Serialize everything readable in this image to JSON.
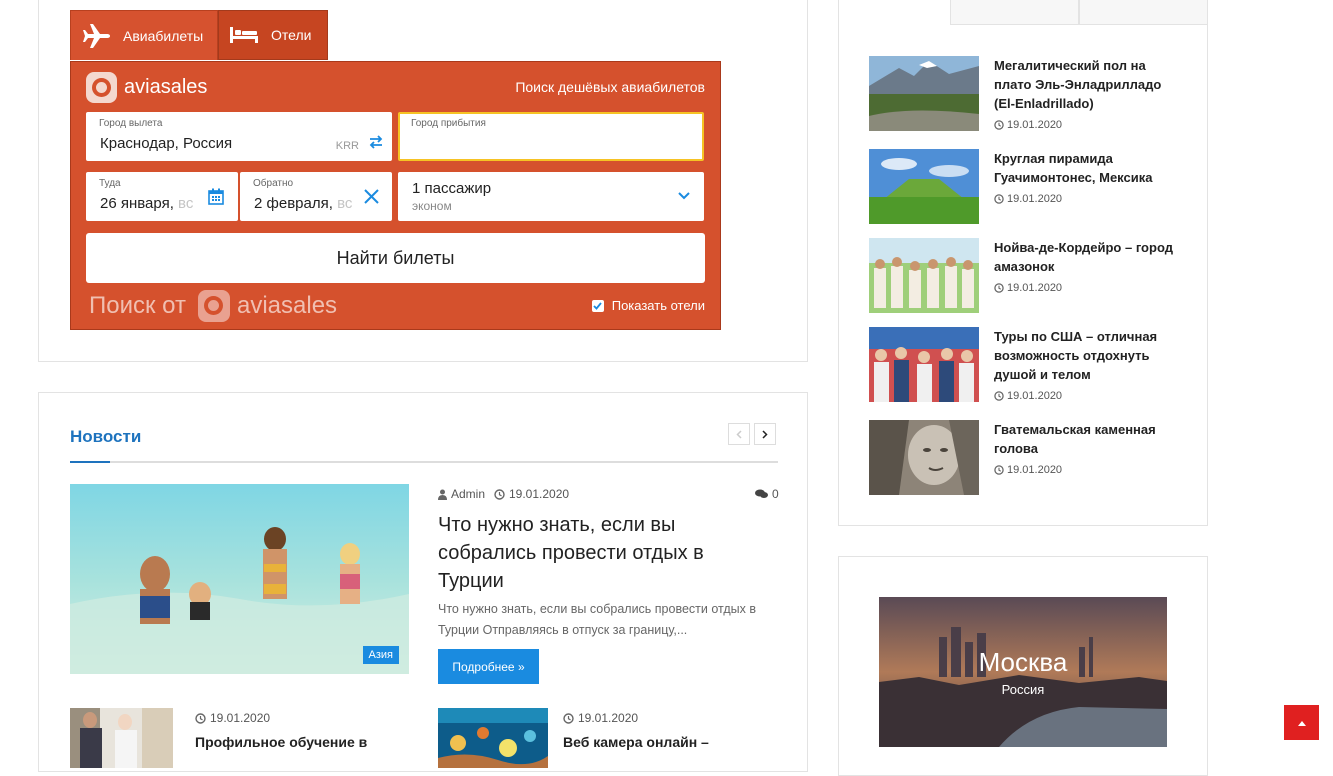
{
  "flight_widget": {
    "tabs": [
      {
        "label": "Авиабилеты",
        "icon": "airplane-icon"
      },
      {
        "label": "Отели",
        "icon": "bed-icon"
      }
    ],
    "brand": "aviasales",
    "tagline": "Поиск дешёвых авиабилетов",
    "origin": {
      "label": "Город вылета",
      "value": "Краснодар, Россия",
      "iata": "KRR"
    },
    "destination": {
      "label": "Город прибытия",
      "value": ""
    },
    "depart": {
      "label": "Туда",
      "value": "26 января,",
      "weekday": "вс"
    },
    "return": {
      "label": "Обратно",
      "value": "2 февраля,",
      "weekday": "вс"
    },
    "passengers": {
      "value": "1 пассажир",
      "class": "эконом"
    },
    "search_button": "Найти билеты",
    "powered_prefix": "Поиск от",
    "powered_brand": "aviasales",
    "show_hotels": "Показать отели",
    "colors": {
      "widget_bg": "#d5512d",
      "dest_focus": "#f6c324"
    }
  },
  "news": {
    "title": "Новости",
    "main": {
      "author": "Admin",
      "date": "19.01.2020",
      "comments": "0",
      "category": "Азия",
      "headline": "Что нужно знать, если вы собрались провести отдых в Турции",
      "excerpt": "Что нужно знать, если вы собрались провести отдых в Турции Отправляясь в отпуск за границу,...",
      "more": "Подробнее »"
    },
    "small": [
      {
        "date": "19.01.2020",
        "title": "Профильное обучение в"
      },
      {
        "date": "19.01.2020",
        "title": "Веб камера онлайн –"
      }
    ]
  },
  "sidebar": {
    "posts": [
      {
        "title": "Мегалитический пол на плато Эль-Энладрилладо (El-Enladrillado)",
        "date": "19.01.2020"
      },
      {
        "title": "Круглая пирамида Гуачимонтонес, Мексика",
        "date": "19.01.2020"
      },
      {
        "title": "Нойва-де-Кордейро – город амазонок",
        "date": "19.01.2020"
      },
      {
        "title": "Туры по США – отличная возможность отдохнуть душой и телом",
        "date": "19.01.2020"
      },
      {
        "title": "Гватемальская каменная голова",
        "date": "19.01.2020"
      }
    ],
    "city": {
      "name": "Москва",
      "country": "Россия"
    }
  },
  "accent": "#1e73be"
}
